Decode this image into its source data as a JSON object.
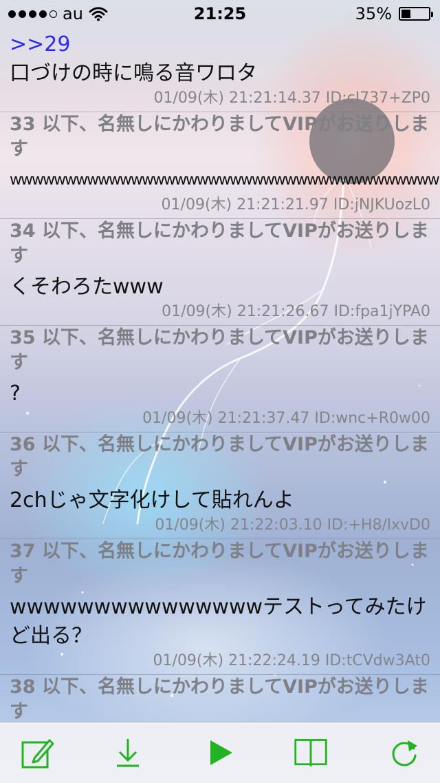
{
  "status_bar": {
    "carrier": "au",
    "time": "21:25",
    "battery_percent": "35%",
    "battery_level": 0.35,
    "signal_bars": 4
  },
  "posts": [
    {
      "header": "",
      "anchor": ">>29",
      "body": "口づけの時に鳴る音ワロタ",
      "meta": "01/09(木) 21:21:14.37 ID:cI737+ZP0"
    },
    {
      "header": "33 以下、名無しにかわりましてVIPがお送りします",
      "anchor": "",
      "body": "wwwwwwwwwwwwwwwwwwwwwwwwwwwwwwwwwwwwwww",
      "meta": "01/09(木) 21:21:21.97 ID:jNJKUozL0"
    },
    {
      "header": "34 以下、名無しにかわりましてVIPがお送りします",
      "anchor": "",
      "body": "くそわろたwww",
      "meta": "01/09(木) 21:21:26.67 ID:fpa1jYPA0"
    },
    {
      "header": "35 以下、名無しにかわりましてVIPがお送りします",
      "anchor": "",
      "body": "?",
      "meta": "01/09(木) 21:21:37.47 ID:wnc+R0w00"
    },
    {
      "header": "36 以下、名無しにかわりましてVIPがお送りします",
      "anchor": "",
      "body": "2chじゃ文字化けして貼れんよ",
      "meta": "01/09(木) 21:22:03.10 ID:+H8/lxvD0"
    },
    {
      "header": "37 以下、名無しにかわりましてVIPがお送りします",
      "anchor": "",
      "body": "wwwwwwwwwwwwwwwテストってみたけど出る？",
      "meta": "01/09(木) 21:22:24.19 ID:tCVdw3At0"
    },
    {
      "header": "38 以下、名無しにかわりましてVIPがお送りします",
      "anchor": "",
      "body": "",
      "meta": ""
    }
  ],
  "toolbar": {
    "accent_color": "#22b322",
    "icons": [
      "compose-icon",
      "download-icon",
      "play-icon",
      "bookmark-book-icon",
      "refresh-icon"
    ]
  }
}
